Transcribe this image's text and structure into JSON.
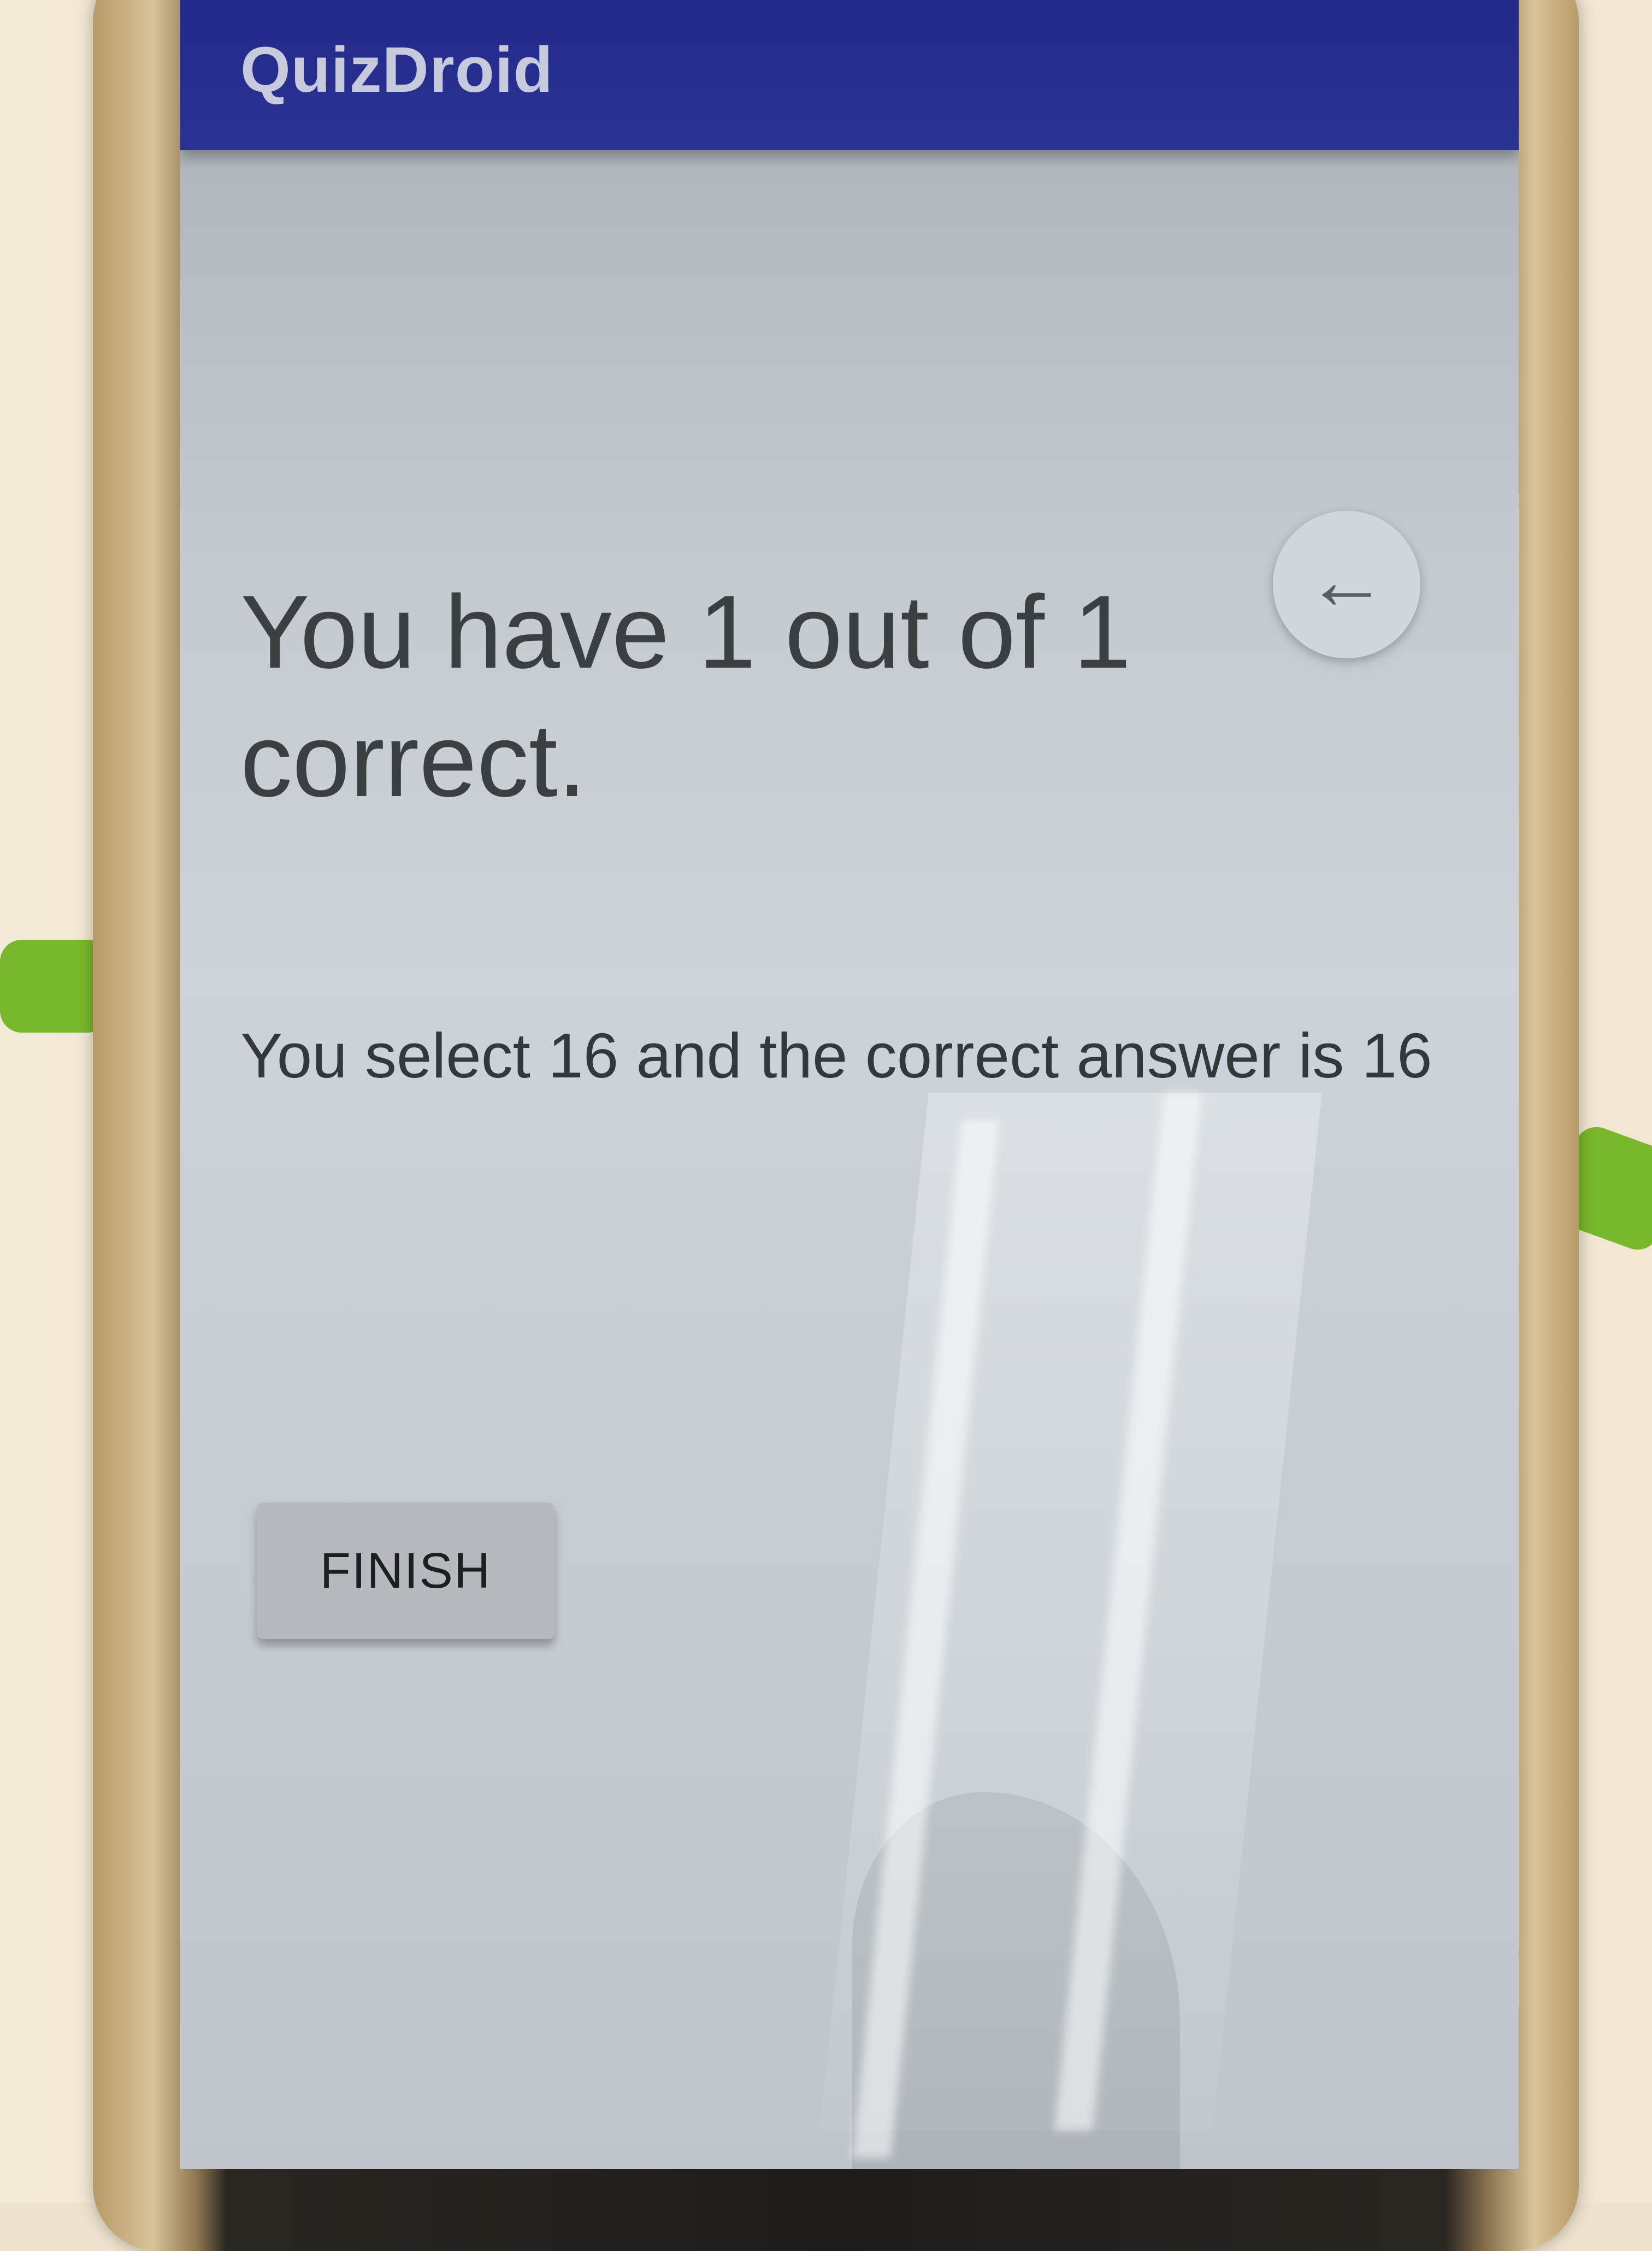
{
  "app_bar": {
    "title": "QuizDroid"
  },
  "result": {
    "score_text": "You have 1 out of 1 correct.",
    "detail_text": "You select 16 and the correct answer is 16"
  },
  "actions": {
    "finish_label": "FINISH",
    "back_icon": "arrow-left-icon"
  },
  "colors": {
    "app_bar": "#232a8a",
    "screen_background": "#c6ccd2",
    "button_background": "#b6b9be"
  }
}
